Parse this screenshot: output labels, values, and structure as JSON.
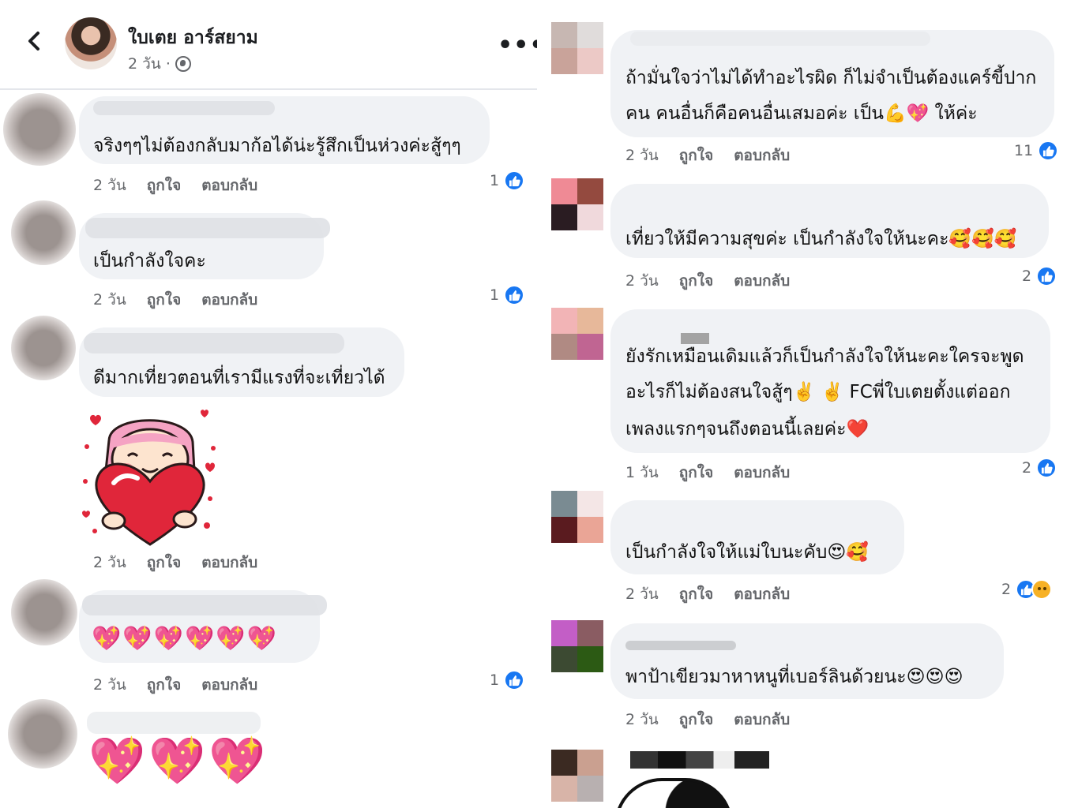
{
  "header": {
    "back_icon": "chevron-left-icon",
    "name": "ใบเตย อาร์สยาม",
    "time": "2 วัน ·",
    "privacy_icon": "globe-icon",
    "more_label": "•••"
  },
  "labels": {
    "like": "ถูกใจ",
    "reply": "ตอบกลับ"
  },
  "left_comments": [
    {
      "text": "จริงๆๆไม่ต้องกลับมาก้อได้น่ะรู้สึกเป็นห่วงค่ะสู้ๆๆ",
      "time": "2 วัน",
      "likes": "1"
    },
    {
      "text": "เป็นกำลังใจคะ",
      "time": "2 วัน",
      "likes": "1"
    },
    {
      "text": "ดีมากเที่ยวตอนที่เรามีแรงที่จะเที่ยวได้",
      "time": "",
      "likes": ""
    },
    {
      "sticker": "heart-hug-sticker",
      "time": "2 วัน",
      "likes": ""
    },
    {
      "text": "💖💖💖💖💖💖",
      "time": "2 วัน",
      "likes": "1"
    },
    {
      "text": "💖💖💖",
      "time": "",
      "likes": ""
    }
  ],
  "right_comments": [
    {
      "line1": "ถ้ามั่นใจว่าไม่ได้ทำอะไรผิด ก็ไม่จำเป็นต้องแคร์ขี้ปาก",
      "line2": "คน คนอื่นก็คือคนอื่นเสมอค่ะ เป็น💪💖 ให้ค่ะ",
      "time": "2 วัน",
      "likes": "11"
    },
    {
      "line1": "เที่ยวให้มีความสุขค่ะ เป็นกำลังใจให้นะคะ🥰🥰🥰",
      "time": "2 วัน",
      "likes": "2"
    },
    {
      "line1": "ยังรักเหมือนเดิมแล้วก็เป็นกำลังใจให้นะคะใครจะพูด",
      "line2": "อะไรก็ไม่ต้องสนใจสู้ๆ✌️ ✌️ FCพี่ใบเตยตั้งแต่ออก",
      "line3": "เพลงแรกๆจนถึงตอนนี้เลยค่ะ❤️",
      "time": "1 วัน",
      "likes": "2"
    },
    {
      "line1": "เป็นกำลังใจให้แม่ใบนะคับ😍🥰",
      "time": "2 วัน",
      "likes": "2"
    },
    {
      "line1": "พาป้าเขียวมาหาหนูที่เบอร์ลินด้วยนะ😍😍😍",
      "time": "2 วัน",
      "likes": ""
    }
  ],
  "colors": {
    "like_blue": "#1877f2",
    "bubble": "#f0f2f5",
    "meta_gray": "#65676b"
  }
}
